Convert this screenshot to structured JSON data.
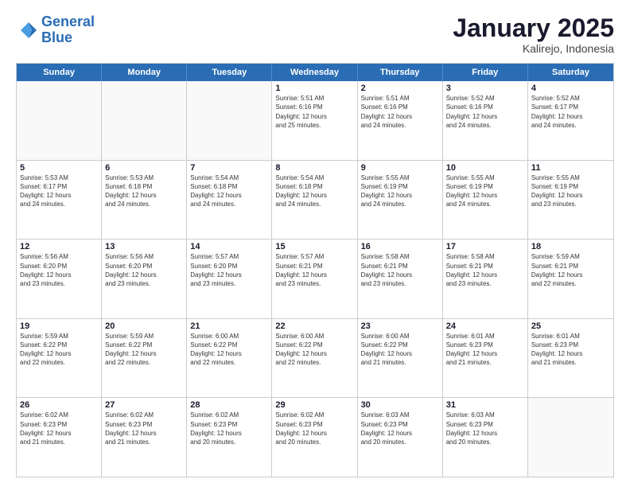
{
  "header": {
    "logo_line1": "General",
    "logo_line2": "Blue",
    "month": "January 2025",
    "location": "Kalirejo, Indonesia"
  },
  "days_of_week": [
    "Sunday",
    "Monday",
    "Tuesday",
    "Wednesday",
    "Thursday",
    "Friday",
    "Saturday"
  ],
  "weeks": [
    [
      {
        "day": "",
        "info": ""
      },
      {
        "day": "",
        "info": ""
      },
      {
        "day": "",
        "info": ""
      },
      {
        "day": "1",
        "info": "Sunrise: 5:51 AM\nSunset: 6:16 PM\nDaylight: 12 hours\nand 25 minutes."
      },
      {
        "day": "2",
        "info": "Sunrise: 5:51 AM\nSunset: 6:16 PM\nDaylight: 12 hours\nand 24 minutes."
      },
      {
        "day": "3",
        "info": "Sunrise: 5:52 AM\nSunset: 6:16 PM\nDaylight: 12 hours\nand 24 minutes."
      },
      {
        "day": "4",
        "info": "Sunrise: 5:52 AM\nSunset: 6:17 PM\nDaylight: 12 hours\nand 24 minutes."
      }
    ],
    [
      {
        "day": "5",
        "info": "Sunrise: 5:53 AM\nSunset: 6:17 PM\nDaylight: 12 hours\nand 24 minutes."
      },
      {
        "day": "6",
        "info": "Sunrise: 5:53 AM\nSunset: 6:18 PM\nDaylight: 12 hours\nand 24 minutes."
      },
      {
        "day": "7",
        "info": "Sunrise: 5:54 AM\nSunset: 6:18 PM\nDaylight: 12 hours\nand 24 minutes."
      },
      {
        "day": "8",
        "info": "Sunrise: 5:54 AM\nSunset: 6:18 PM\nDaylight: 12 hours\nand 24 minutes."
      },
      {
        "day": "9",
        "info": "Sunrise: 5:55 AM\nSunset: 6:19 PM\nDaylight: 12 hours\nand 24 minutes."
      },
      {
        "day": "10",
        "info": "Sunrise: 5:55 AM\nSunset: 6:19 PM\nDaylight: 12 hours\nand 24 minutes."
      },
      {
        "day": "11",
        "info": "Sunrise: 5:55 AM\nSunset: 6:19 PM\nDaylight: 12 hours\nand 23 minutes."
      }
    ],
    [
      {
        "day": "12",
        "info": "Sunrise: 5:56 AM\nSunset: 6:20 PM\nDaylight: 12 hours\nand 23 minutes."
      },
      {
        "day": "13",
        "info": "Sunrise: 5:56 AM\nSunset: 6:20 PM\nDaylight: 12 hours\nand 23 minutes."
      },
      {
        "day": "14",
        "info": "Sunrise: 5:57 AM\nSunset: 6:20 PM\nDaylight: 12 hours\nand 23 minutes."
      },
      {
        "day": "15",
        "info": "Sunrise: 5:57 AM\nSunset: 6:21 PM\nDaylight: 12 hours\nand 23 minutes."
      },
      {
        "day": "16",
        "info": "Sunrise: 5:58 AM\nSunset: 6:21 PM\nDaylight: 12 hours\nand 23 minutes."
      },
      {
        "day": "17",
        "info": "Sunrise: 5:58 AM\nSunset: 6:21 PM\nDaylight: 12 hours\nand 23 minutes."
      },
      {
        "day": "18",
        "info": "Sunrise: 5:59 AM\nSunset: 6:21 PM\nDaylight: 12 hours\nand 22 minutes."
      }
    ],
    [
      {
        "day": "19",
        "info": "Sunrise: 5:59 AM\nSunset: 6:22 PM\nDaylight: 12 hours\nand 22 minutes."
      },
      {
        "day": "20",
        "info": "Sunrise: 5:59 AM\nSunset: 6:22 PM\nDaylight: 12 hours\nand 22 minutes."
      },
      {
        "day": "21",
        "info": "Sunrise: 6:00 AM\nSunset: 6:22 PM\nDaylight: 12 hours\nand 22 minutes."
      },
      {
        "day": "22",
        "info": "Sunrise: 6:00 AM\nSunset: 6:22 PM\nDaylight: 12 hours\nand 22 minutes."
      },
      {
        "day": "23",
        "info": "Sunrise: 6:00 AM\nSunset: 6:22 PM\nDaylight: 12 hours\nand 21 minutes."
      },
      {
        "day": "24",
        "info": "Sunrise: 6:01 AM\nSunset: 6:23 PM\nDaylight: 12 hours\nand 21 minutes."
      },
      {
        "day": "25",
        "info": "Sunrise: 6:01 AM\nSunset: 6:23 PM\nDaylight: 12 hours\nand 21 minutes."
      }
    ],
    [
      {
        "day": "26",
        "info": "Sunrise: 6:02 AM\nSunset: 6:23 PM\nDaylight: 12 hours\nand 21 minutes."
      },
      {
        "day": "27",
        "info": "Sunrise: 6:02 AM\nSunset: 6:23 PM\nDaylight: 12 hours\nand 21 minutes."
      },
      {
        "day": "28",
        "info": "Sunrise: 6:02 AM\nSunset: 6:23 PM\nDaylight: 12 hours\nand 20 minutes."
      },
      {
        "day": "29",
        "info": "Sunrise: 6:02 AM\nSunset: 6:23 PM\nDaylight: 12 hours\nand 20 minutes."
      },
      {
        "day": "30",
        "info": "Sunrise: 6:03 AM\nSunset: 6:23 PM\nDaylight: 12 hours\nand 20 minutes."
      },
      {
        "day": "31",
        "info": "Sunrise: 6:03 AM\nSunset: 6:23 PM\nDaylight: 12 hours\nand 20 minutes."
      },
      {
        "day": "",
        "info": ""
      }
    ]
  ]
}
